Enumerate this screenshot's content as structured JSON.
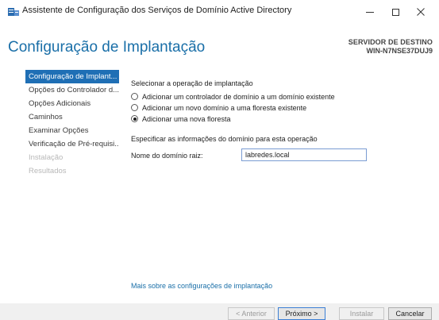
{
  "window": {
    "title": "Assistente de Configuração dos Serviços de Domínio Active Directory",
    "icon": "server-icon"
  },
  "header": {
    "title": "Configuração de Implantação",
    "dest_label": "SERVIDOR DE DESTINO",
    "dest_server": "WIN-N7NSE37DUJ9"
  },
  "nav": {
    "items": [
      {
        "label": "Configuração de Implant...",
        "state": "active"
      },
      {
        "label": "Opções do Controlador d...",
        "state": "normal"
      },
      {
        "label": "Opções Adicionais",
        "state": "normal"
      },
      {
        "label": "Caminhos",
        "state": "normal"
      },
      {
        "label": "Examinar Opções",
        "state": "normal"
      },
      {
        "label": "Verificação de Pré-requisi...",
        "state": "normal"
      },
      {
        "label": "Instalação",
        "state": "disabled"
      },
      {
        "label": "Resultados",
        "state": "disabled"
      }
    ]
  },
  "content": {
    "operation_label": "Selecionar a operação de implantação",
    "options": [
      {
        "label": "Adicionar um controlador de domínio a um domínio existente",
        "checked": false
      },
      {
        "label": "Adicionar um novo domínio a uma floresta existente",
        "checked": false
      },
      {
        "label": "Adicionar uma nova floresta",
        "checked": true
      }
    ],
    "domain_info_label": "Especificar as informações do domínio para esta operação",
    "root_domain_label": "Nome do domínio raiz:",
    "root_domain_value": "labredes.local",
    "more_link": "Mais sobre as configurações de implantação"
  },
  "footer": {
    "prev_label": "< Anterior",
    "next_label": "Próximo >",
    "install_label": "Instalar",
    "cancel_label": "Cancelar"
  },
  "colors": {
    "accent": "#1a6fa8",
    "nav_active": "#1f6fb5",
    "disabled": "#b8b8b8"
  }
}
